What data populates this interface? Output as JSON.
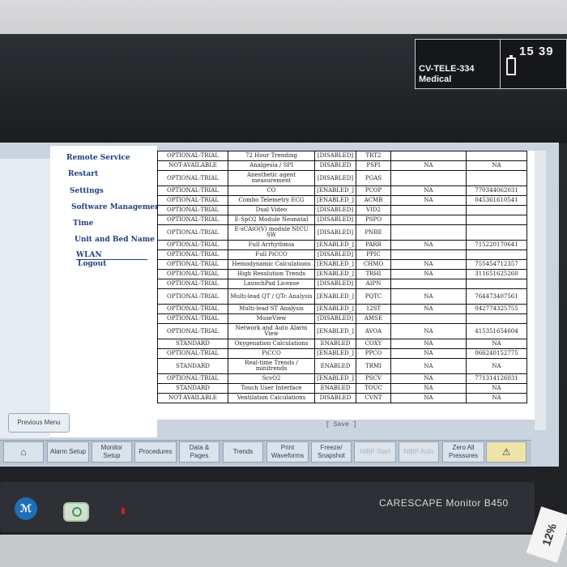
{
  "status": {
    "unit_name": "CV-TELE-334",
    "unit_sub": "Medical",
    "time": "15 39"
  },
  "side_menu": {
    "items": [
      "Remote Service",
      "Restart",
      "Settings",
      "Software Management",
      "Time",
      "Unit and Bed Name",
      "WLAN",
      "Logout"
    ],
    "previous_label": "Previous Menu"
  },
  "table": {
    "rows": [
      [
        "OPTIONAL-TRIAL",
        "72 Hour Trending",
        "[DISABLED]",
        "TRT2",
        "",
        ""
      ],
      [
        "NOT-AVAILABLE",
        "Analgesia / SPI",
        "DISABLED",
        "PSPI",
        "NA",
        "NA"
      ],
      [
        "OPTIONAL-TRIAL",
        "Anesthetic agent measurement",
        "[DISABLED]",
        "PGAS",
        "",
        ""
      ],
      [
        "OPTIONAL-TRIAL",
        "CO",
        "[ENABLED_]",
        "PCOP",
        "NA",
        "770344062031"
      ],
      [
        "OPTIONAL-TRIAL",
        "Combo Telemetry ECG",
        "[ENABLED_]",
        "ACMB",
        "NA",
        "045361610541"
      ],
      [
        "OPTIONAL-TRIAL",
        "Dual Video",
        "[DISABLED]",
        "VID2",
        "",
        ""
      ],
      [
        "OPTIONAL-TRIAL",
        "E-SpO2 Module Neonatal",
        "[DISABLED]",
        "PSPO",
        "",
        ""
      ],
      [
        "OPTIONAL-TRIAL",
        "E-sCAiO(V) module NICU SW",
        "[DISABLED]",
        "PNRE",
        "",
        ""
      ],
      [
        "OPTIONAL-TRIAL",
        "Full Arrhythmia",
        "[ENABLED_]",
        "PARR",
        "NA",
        "715220170641"
      ],
      [
        "OPTIONAL-TRIAL",
        "Full PiCCO",
        "[DISABLED]",
        "PPIC",
        "",
        ""
      ],
      [
        "OPTIONAL-TRIAL",
        "Hemodynamic Calculations",
        "[ENABLED_]",
        "CHMO",
        "NA",
        "755454712357"
      ],
      [
        "OPTIONAL-TRIAL",
        "High Resolution Trends",
        "[ENABLED_]",
        "TRHI",
        "NA",
        "311651625260"
      ],
      [
        "OPTIONAL-TRIAL",
        "LaunchPad License",
        "[DISABLED]",
        "AIPN",
        "",
        ""
      ],
      [
        "OPTIONAL-TRIAL",
        "Multi-lead QT / QTc Analysis",
        "[ENABLED_]",
        "PQTC",
        "NA",
        "764473407561"
      ],
      [
        "OPTIONAL-TRIAL",
        "Multi-lead ST Analysis",
        "[ENABLED_]",
        "12ST",
        "NA",
        "042774325755"
      ],
      [
        "OPTIONAL-TRIAL",
        "MuseView",
        "[DISABLED]",
        "AMSE",
        "",
        ""
      ],
      [
        "OPTIONAL-TRIAL",
        "Network and Auto Alarm View",
        "[ENABLED_]",
        "AVOA",
        "NA",
        "415351654604"
      ],
      [
        "STANDARD",
        "Oxygenation Calculations",
        "ENABLED",
        "COXY",
        "NA",
        "NA"
      ],
      [
        "OPTIONAL-TRIAL",
        "PiCCO",
        "[ENABLED_]",
        "PPCO",
        "NA",
        "066240152775"
      ],
      [
        "STANDARD",
        "Real-time Trends / minitrends",
        "ENABLED",
        "TRMI",
        "NA",
        "NA"
      ],
      [
        "OPTIONAL-TRIAL",
        "ScvO2",
        "[ENABLED_]",
        "PSCV",
        "NA",
        "771314126031"
      ],
      [
        "STANDARD",
        "Touch User Interface",
        "ENABLED",
        "TOUC",
        "NA",
        "NA"
      ],
      [
        "NOT-AVAILABLE",
        "Ventilation Calculations",
        "DISABLED",
        "CVNT",
        "NA",
        "NA"
      ]
    ],
    "save_label": "[ Save ]"
  },
  "bottom_tabs": [
    {
      "label": "",
      "name": "home-icon"
    },
    {
      "label": "Alarm Setup"
    },
    {
      "label": "Monitor Setup"
    },
    {
      "label": "Procedures"
    },
    {
      "label": "Data & Pages"
    },
    {
      "label": "Trends"
    },
    {
      "label": "Print Waveforms"
    },
    {
      "label": "Freeze/ Snapshot"
    },
    {
      "label": "NIBP Start"
    },
    {
      "label": "NIBP Auto"
    },
    {
      "label": "Zero All Pressures"
    },
    {
      "label": "",
      "name": "alarm-silence-icon"
    }
  ],
  "device": {
    "brand": "CARESCAPE Monitor B450",
    "tag": "12%"
  }
}
